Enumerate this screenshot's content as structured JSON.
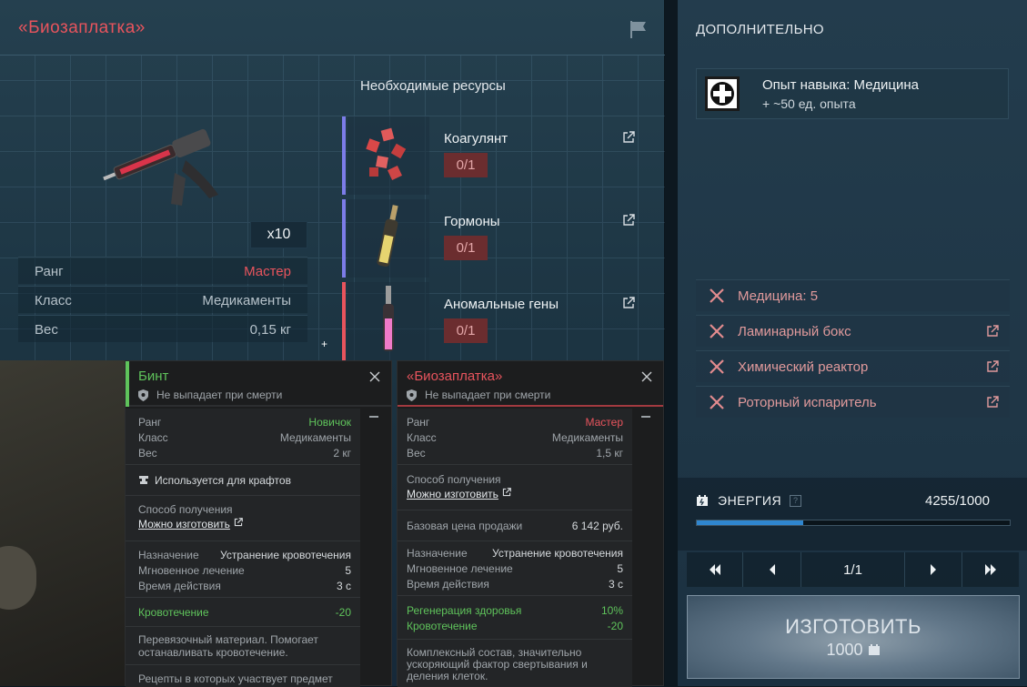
{
  "main": {
    "title": "«Биозаплатка»",
    "quantity": "x10",
    "stats": [
      {
        "key": "Ранг",
        "value": "Мастер",
        "accent": "#e8545d"
      },
      {
        "key": "Класс",
        "value": "Медикаменты",
        "accent": ""
      },
      {
        "key": "Вес",
        "value": "0,15 кг",
        "accent": ""
      }
    ],
    "resources_heading": "Необходимые ресурсы",
    "resources": [
      {
        "name": "Коагулянт",
        "count": "0/1",
        "rarity_color": "#7c7ce8"
      },
      {
        "name": "Гормоны",
        "count": "0/1",
        "rarity_color": "#7c7ce8"
      },
      {
        "name": "Аномальные гены",
        "count": "0/1",
        "rarity_color": "#e8545d"
      }
    ]
  },
  "extra": {
    "title": "ДОПОЛНИТЕЛЬНО",
    "skill_name": "Опыт навыка: Медицина",
    "skill_value": "+ ~50 ед. опыта",
    "requirements": [
      {
        "label": "Медицина: 5",
        "link": false
      },
      {
        "label": "Ламинарный бокс",
        "link": true
      },
      {
        "label": "Химический реактор",
        "link": true
      },
      {
        "label": "Роторный испаритель",
        "link": true
      }
    ],
    "energy_label": "ЭНЕРГИЯ",
    "energy_help": "?",
    "energy_value": "4255/1000",
    "energy_fill": 0.34,
    "page": "1/1",
    "craft_label": "ИЗГОТОВИТЬ",
    "craft_cost": "1000"
  },
  "tooltips": [
    {
      "name": "Бинт",
      "color": "#5fc35b",
      "nodrop": "Не выпадает при смерти",
      "rank_key": "Ранг",
      "rank": "Новичок",
      "class_key": "Класс",
      "class": "Медикаменты",
      "weight_key": "Вес",
      "weight": "2 кг",
      "used": "Используется для крафтов",
      "obtain_key": "Способ получения",
      "obtain": "Можно изготовить",
      "purpose_key": "Назначение",
      "purpose": "Устранение кровотечения",
      "heal_key": "Мгновенное лечение",
      "heal": "5",
      "time_key": "Время действия",
      "time": "3 с",
      "effect_key": "Кровотечение",
      "effect": "-20",
      "desc": "Перевязочный материал. Помогает останавливать кровотечение.",
      "recipes": "Рецепты в которых участвует предмет"
    },
    {
      "name": "«Биозаплатка»",
      "color": "#e8545d",
      "nodrop": "Не выпадает при смерти",
      "rank_key": "Ранг",
      "rank": "Мастер",
      "class_key": "Класс",
      "class": "Медикаменты",
      "weight_key": "Вес",
      "weight": "1,5 кг",
      "obtain_key": "Способ получения",
      "obtain": "Можно изготовить",
      "price_key": "Базовая цена продажи",
      "price": "6 142 руб.",
      "purpose_key": "Назначение",
      "purpose": "Устранение кровотечения",
      "heal_key": "Мгновенное лечение",
      "heal": "5",
      "time_key": "Время действия",
      "time": "3 с",
      "regen_key": "Регенерация здоровья",
      "regen": "10%",
      "effect_key": "Кровотечение",
      "effect": "-20",
      "desc": "Комплексный состав, значительно ускоряющий фактор свертывания и деления клеток."
    }
  ]
}
